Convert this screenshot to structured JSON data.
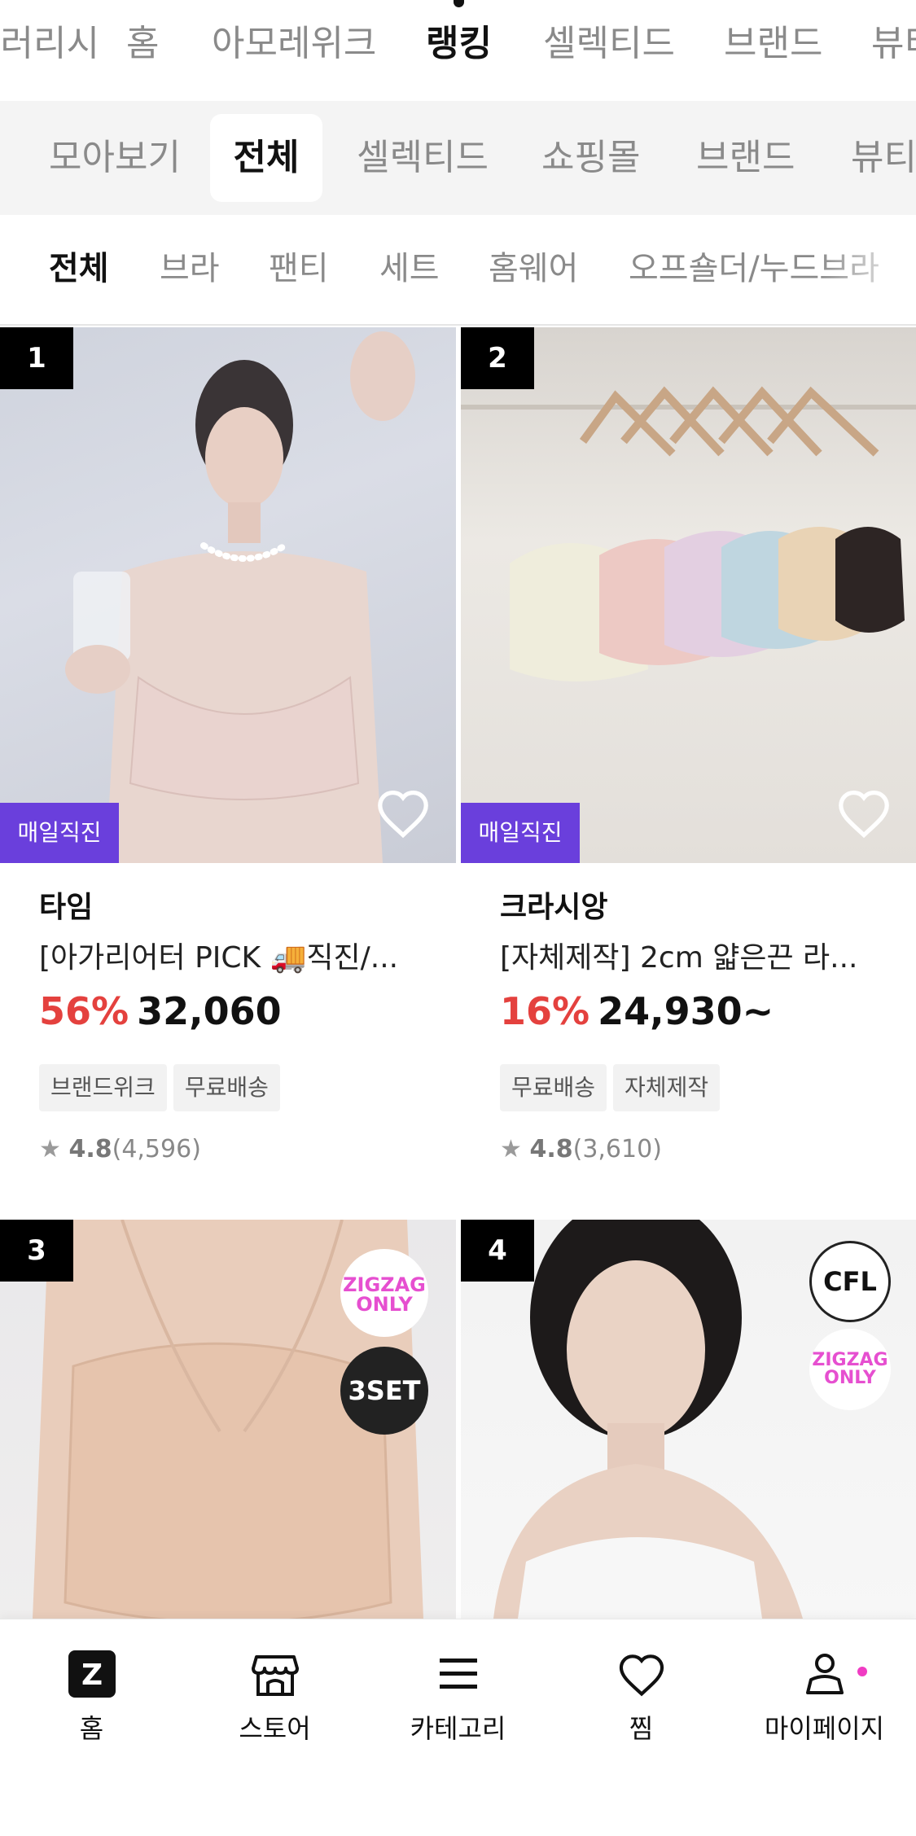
{
  "top_tabs": [
    {
      "label": "갤러리시",
      "active": false
    },
    {
      "label": "홈",
      "active": false
    },
    {
      "label": "아모레위크",
      "active": false
    },
    {
      "label": "랭킹",
      "active": true
    },
    {
      "label": "셀렉티드",
      "active": false
    },
    {
      "label": "브랜드",
      "active": false
    },
    {
      "label": "뷰티",
      "active": false
    }
  ],
  "categories": [
    {
      "label": "모아보기",
      "active": false
    },
    {
      "label": "전체",
      "active": true
    },
    {
      "label": "셀렉티드",
      "active": false
    },
    {
      "label": "쇼핑몰",
      "active": false
    },
    {
      "label": "브랜드",
      "active": false
    },
    {
      "label": "뷰티",
      "active": false
    }
  ],
  "sub_filters": [
    {
      "label": "전체",
      "active": true
    },
    {
      "label": "브라",
      "active": false
    },
    {
      "label": "팬티",
      "active": false
    },
    {
      "label": "세트",
      "active": false
    },
    {
      "label": "홈웨어",
      "active": false
    },
    {
      "label": "오프숄더/누드브라",
      "active": false
    }
  ],
  "products": [
    {
      "rank": "1",
      "badge": "매일직진",
      "shop": "타임",
      "title": "[아가리어터 PICK 🚚직진/...",
      "discount": "56%",
      "price": "32,060",
      "tags": [
        "브랜드위크",
        "무료배송"
      ],
      "rating": "4.8",
      "reviews": "(4,596)"
    },
    {
      "rank": "2",
      "badge": "매일직진",
      "shop": "크라시앙",
      "title": "[자체제작] 2cm 얇은끈 라...",
      "discount": "16%",
      "price": "24,930~",
      "tags": [
        "무료배송",
        "자체제작"
      ],
      "rating": "4.8",
      "reviews": "(3,610)"
    },
    {
      "rank": "3",
      "badges": [
        "ZIGZAG ONLY",
        "3SET"
      ]
    },
    {
      "rank": "4",
      "badges": [
        "CFL",
        "ZIGZAG ONLY"
      ]
    }
  ],
  "bottom_nav": [
    {
      "label": "홈",
      "icon": "zigzag-logo-icon"
    },
    {
      "label": "스토어",
      "icon": "store-icon"
    },
    {
      "label": "카테고리",
      "icon": "menu-icon"
    },
    {
      "label": "찜",
      "icon": "heart-icon"
    },
    {
      "label": "마이페이지",
      "icon": "user-icon"
    }
  ],
  "colors": {
    "accent_purple": "#6a3fdc",
    "discount_red": "#e4413e",
    "notification_pink": "#f03cc3"
  }
}
